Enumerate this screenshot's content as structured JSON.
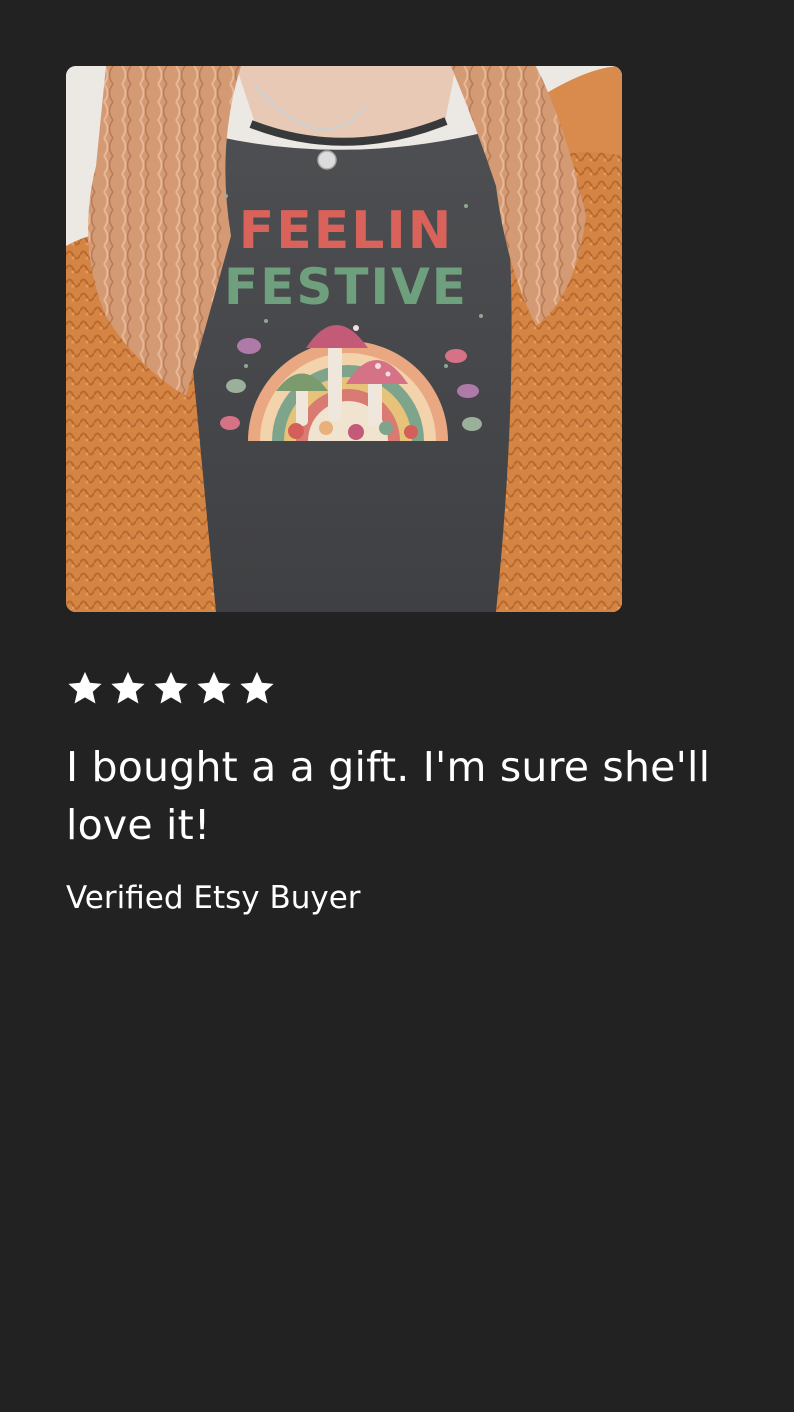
{
  "review": {
    "rating": 5,
    "rating_max": 5,
    "text": "I bought a a gift. I'm sure she'll love it!",
    "reviewer": "Verified Etsy Buyer"
  },
  "photo": {
    "shirt_text_line1": "FEELIN",
    "shirt_text_line2": "FESTIVE"
  },
  "colors": {
    "background": "#222222",
    "text": "#ffffff",
    "star": "#ffffff",
    "shirt": "#4a4b4d",
    "cardigan": "#d98745",
    "hair": "#d9a07a"
  },
  "icons": {
    "rating_star": "star-icon"
  }
}
